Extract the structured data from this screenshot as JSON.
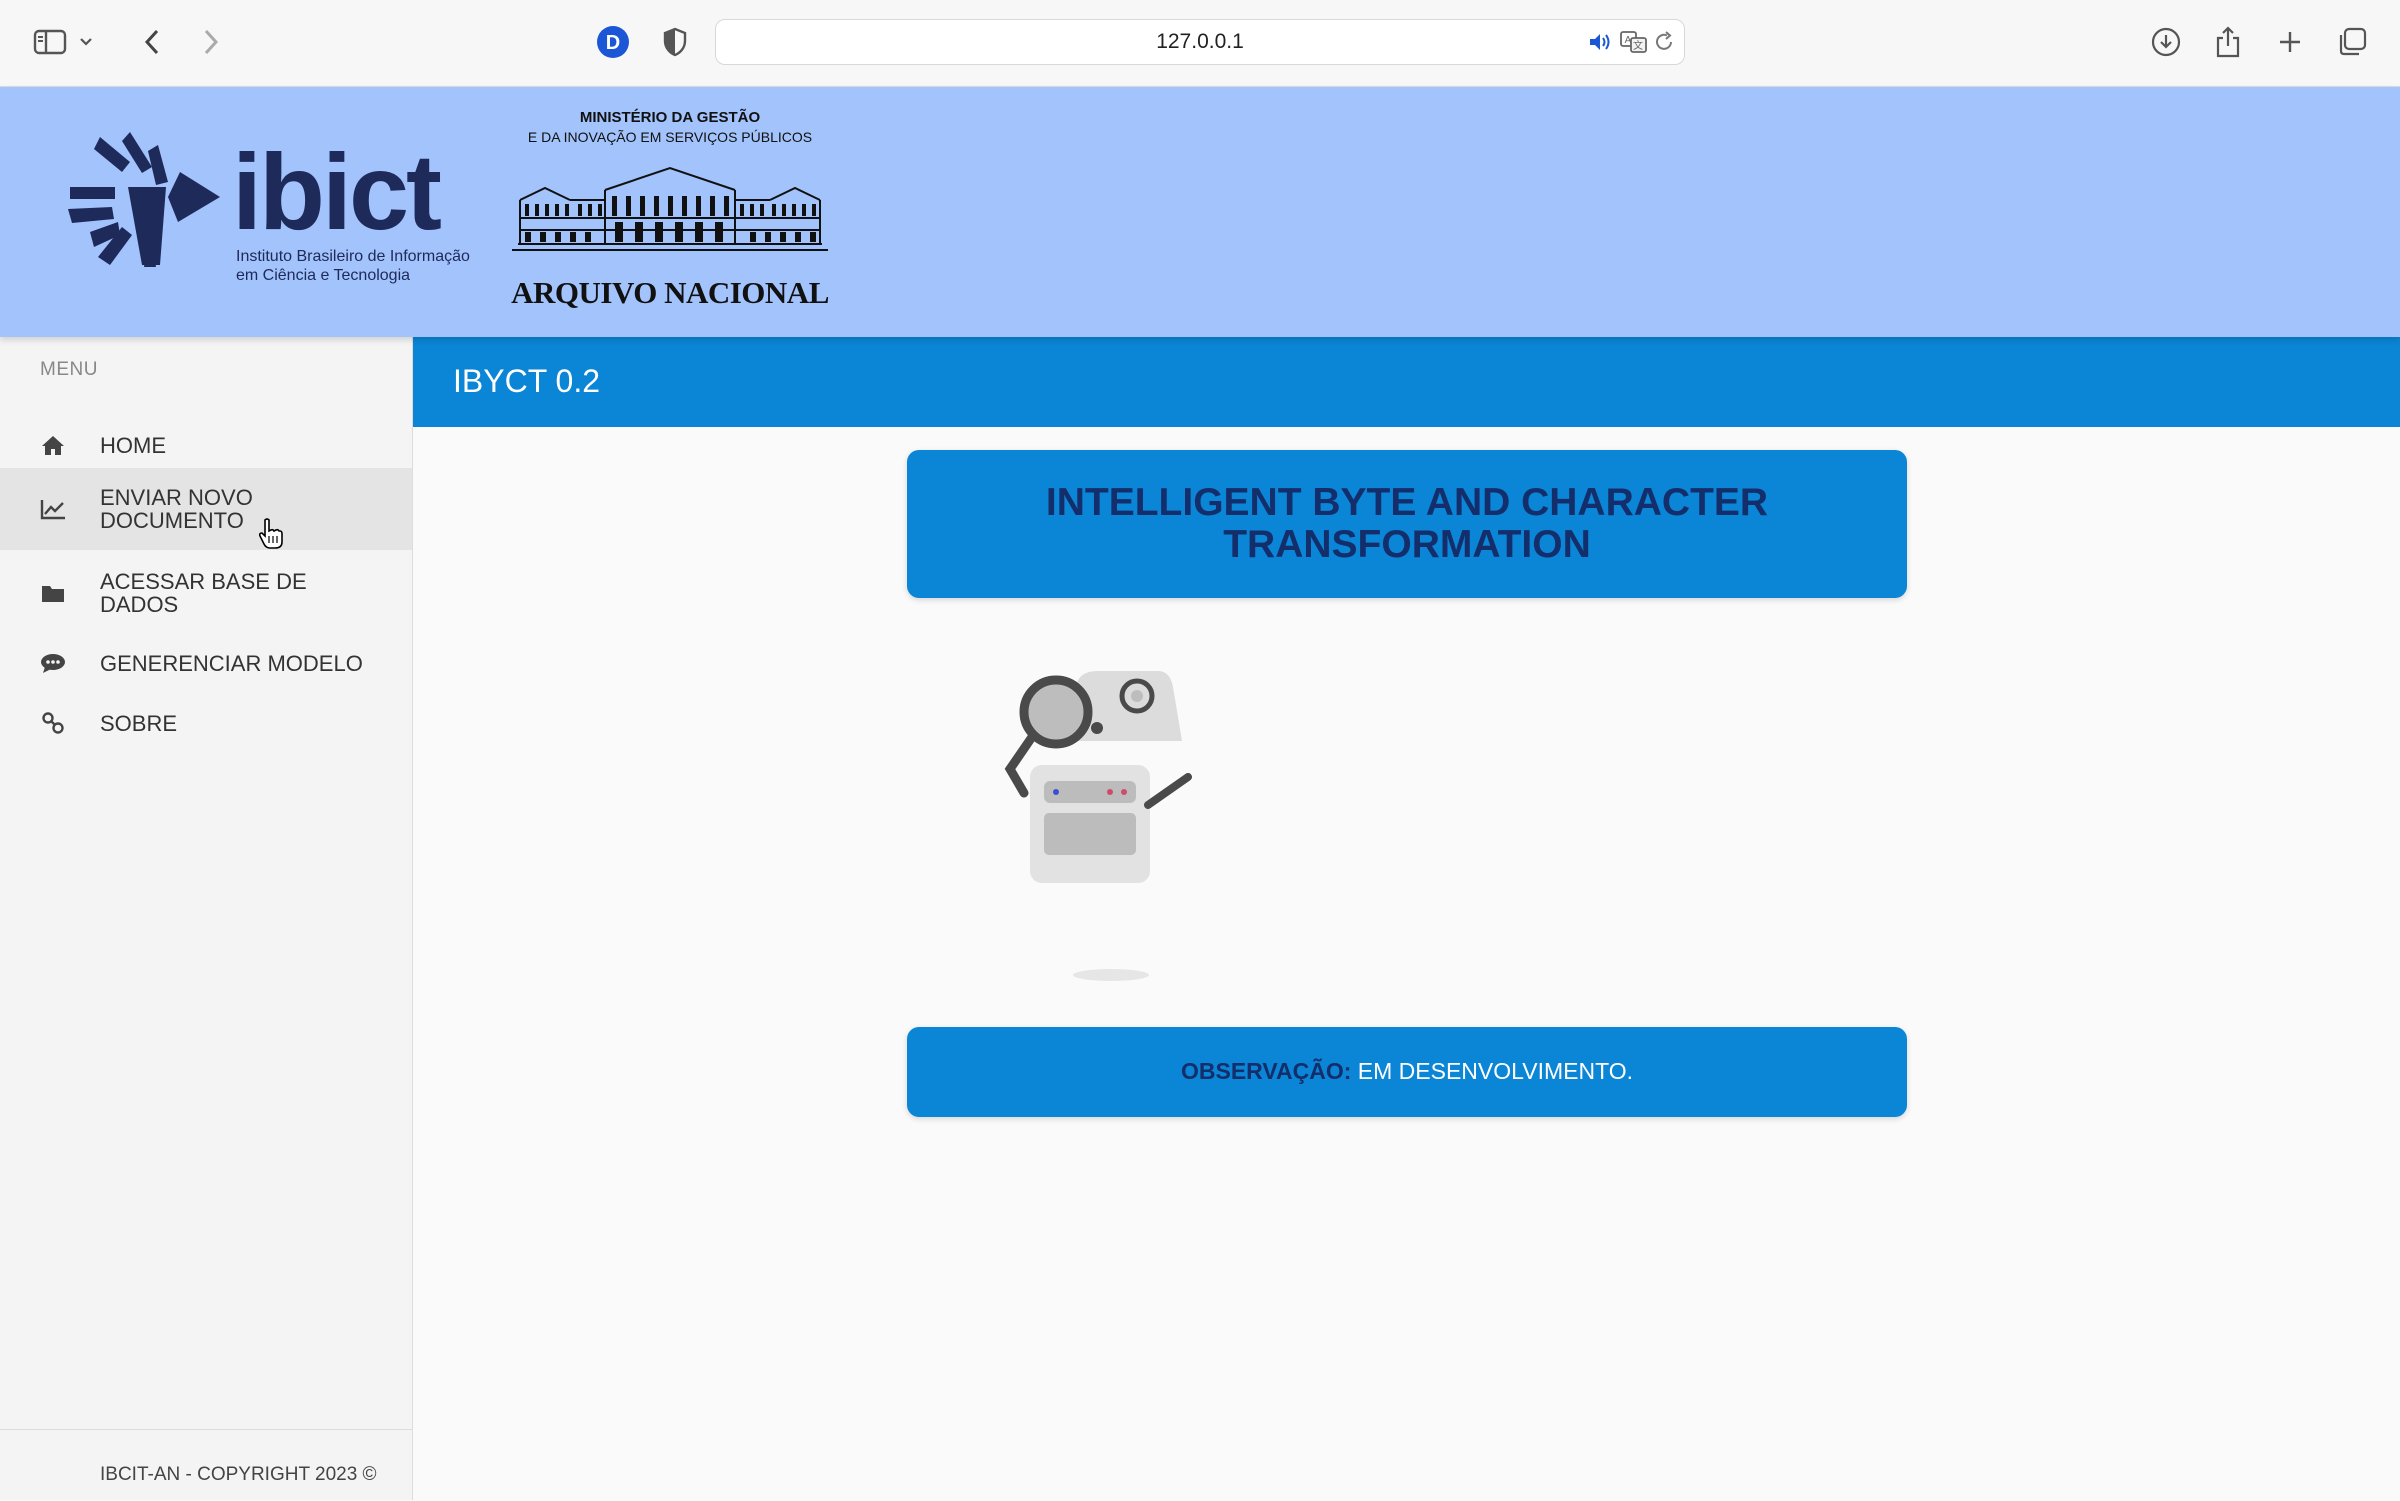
{
  "browser": {
    "url": "127.0.0.1",
    "extension_badge": "D"
  },
  "header": {
    "ibict_wordmark": "ibict",
    "ibict_tagline_line1": "Instituto Brasileiro de Informação",
    "ibict_tagline_line2": "em Ciência e Tecnologia",
    "ministry_line1": "MINISTÉRIO DA GESTÃO",
    "ministry_line2": "E DA INOVAÇÃO EM SERVIÇOS PÚBLICOS",
    "archive_name": "ARQUIVO NACIONAL"
  },
  "sidebar": {
    "caption": "MENU",
    "items": [
      {
        "label": "HOME",
        "icon": "home-icon"
      },
      {
        "label": "ENVIAR NOVO DOCUMENTO",
        "icon": "line-chart-icon"
      },
      {
        "label": "ACESSAR BASE DE DADOS",
        "icon": "folder-icon"
      },
      {
        "label": "GENERENCIAR MODELO",
        "icon": "chat-bubble-icon"
      },
      {
        "label": "SOBRE",
        "icon": "link-icon"
      }
    ],
    "active_index": 1,
    "footer": "IBCIT-AN - COPYRIGHT 2023 ©"
  },
  "main": {
    "app_title": "IBYCT 0.2",
    "hero_title_line1": "INTELLIGENT BYTE AND CHARACTER",
    "hero_title_line2": "TRANSFORMATION",
    "note_label": "OBSERVAÇÃO:",
    "note_value": "EM DESENVOLVIMENTO."
  },
  "colors": {
    "banner": "#a2c3fb",
    "accent_blue": "#0b85d6",
    "dark_navy": "#132e6b",
    "sidebar_bg": "#f4f4f4",
    "active_item_bg": "#e4e4e4"
  }
}
